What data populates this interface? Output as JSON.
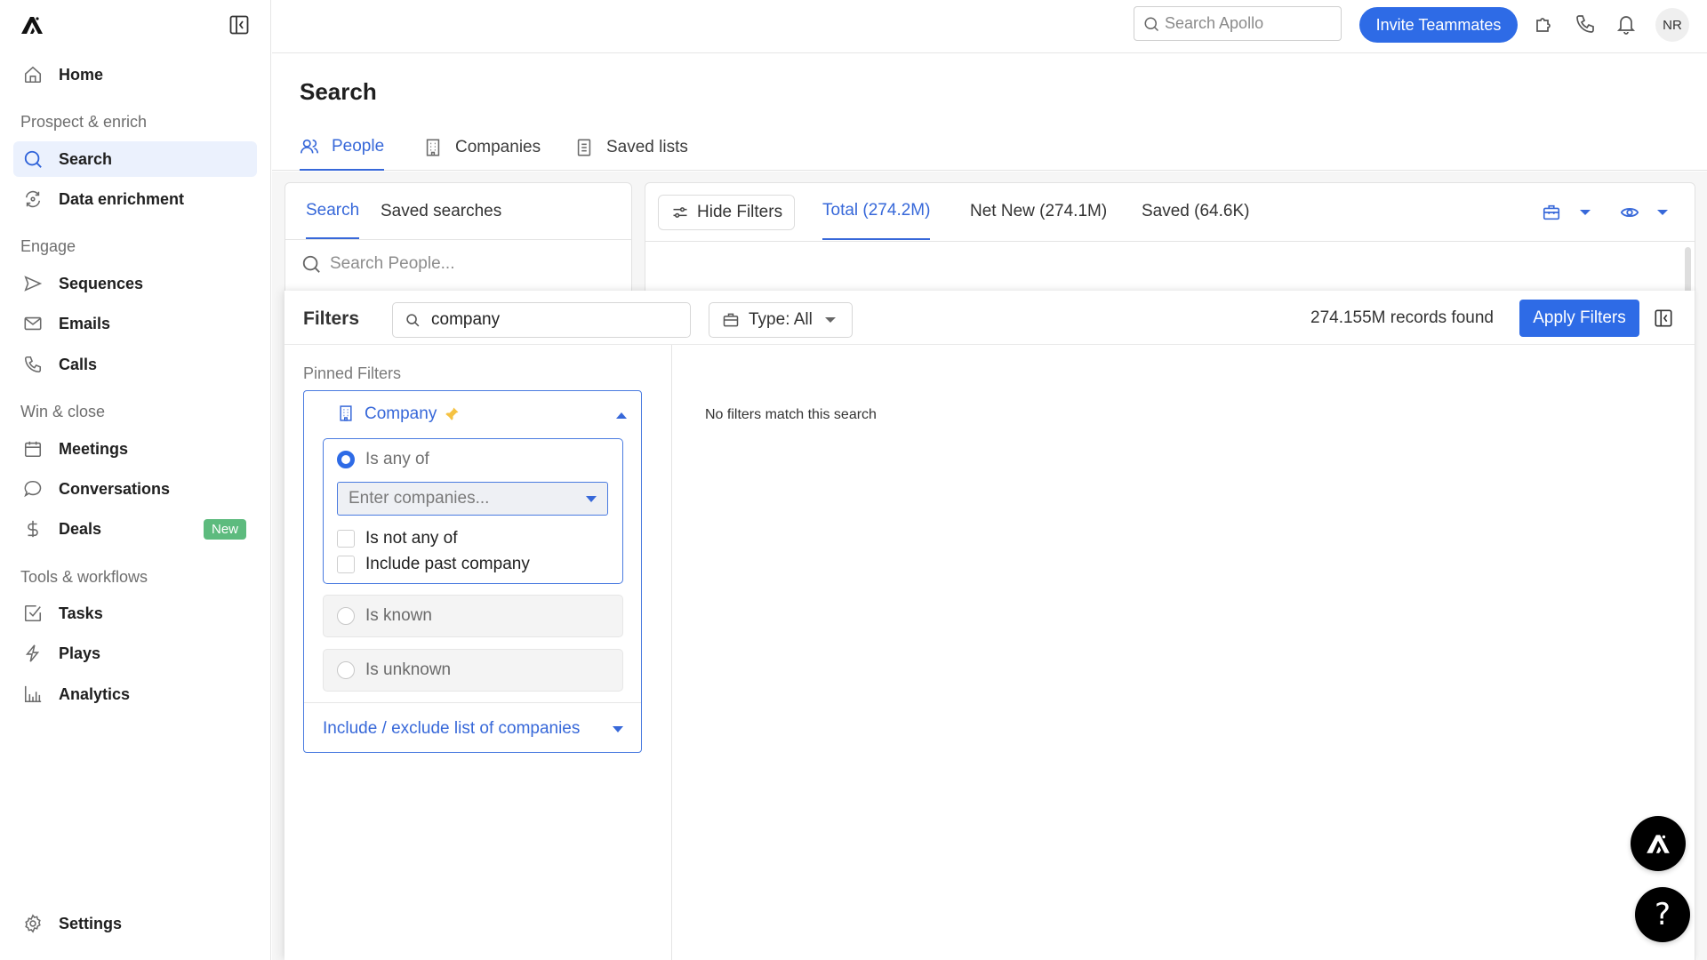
{
  "sidebar": {
    "logo": "apollo-logo",
    "collapse_icon": "sidebar-collapse-icon",
    "home": {
      "label": "Home",
      "icon": "home-icon"
    },
    "sections": [
      {
        "label": "Prospect & enrich",
        "items": [
          {
            "label": "Search",
            "icon": "search-icon",
            "active": true
          },
          {
            "label": "Data enrichment",
            "icon": "refresh-icon",
            "active": false
          }
        ]
      },
      {
        "label": "Engage",
        "items": [
          {
            "label": "Sequences",
            "icon": "send-icon"
          },
          {
            "label": "Emails",
            "icon": "mail-icon"
          },
          {
            "label": "Calls",
            "icon": "phone-icon"
          }
        ]
      },
      {
        "label": "Win & close",
        "items": [
          {
            "label": "Meetings",
            "icon": "calendar-icon"
          },
          {
            "label": "Conversations",
            "icon": "chat-bubble-icon"
          },
          {
            "label": "Deals",
            "icon": "dollar-icon",
            "badge": "New"
          }
        ]
      },
      {
        "label": "Tools & workflows",
        "items": [
          {
            "label": "Tasks",
            "icon": "checkbox-icon"
          },
          {
            "label": "Plays",
            "icon": "lightning-icon"
          },
          {
            "label": "Analytics",
            "icon": "bar-chart-icon"
          }
        ]
      }
    ],
    "settings": {
      "label": "Settings",
      "icon": "gear-icon"
    }
  },
  "topbar": {
    "search_placeholder": "Search Apollo",
    "invite_label": "Invite Teammates",
    "icons": [
      "puzzle-icon",
      "phone-icon",
      "bell-icon"
    ],
    "avatar_initials": "NR"
  },
  "page": {
    "title": "Search",
    "tabs": [
      {
        "label": "People",
        "icon": "people-icon",
        "active": true
      },
      {
        "label": "Companies",
        "icon": "building-icon",
        "active": false
      },
      {
        "label": "Saved lists",
        "icon": "list-icon",
        "active": false
      }
    ]
  },
  "left_panel": {
    "tabs": [
      {
        "label": "Search",
        "active": true
      },
      {
        "label": "Saved searches",
        "active": false
      }
    ],
    "search_placeholder": "Search People..."
  },
  "results_panel": {
    "hide_filters_label": "Hide Filters",
    "tabs": [
      {
        "label": "Total (274.2M)",
        "active": true
      },
      {
        "label": "Net New (274.1M)",
        "active": false
      },
      {
        "label": "Saved (64.6K)",
        "active": false
      }
    ],
    "icons": [
      "briefcase-icon",
      "eye-icon"
    ]
  },
  "filters": {
    "title": "Filters",
    "search_value": "company",
    "type_label": "Type: All",
    "records_found": "274.155M records found",
    "apply_label": "Apply Filters",
    "pinned_label": "Pinned Filters",
    "no_match": "No filters match this search",
    "company_filter": {
      "label": "Company",
      "pinned": true,
      "options": {
        "is_any_of": {
          "label": "Is any of",
          "selected": true
        },
        "input_placeholder": "Enter companies...",
        "is_not_any_of": {
          "label": "Is not any of",
          "checked": false
        },
        "include_past": {
          "label": "Include past company",
          "checked": false
        },
        "is_known": {
          "label": "Is known",
          "selected": false
        },
        "is_unknown": {
          "label": "Is unknown",
          "selected": false
        }
      },
      "include_exclude_label": "Include / exclude list of companies"
    }
  },
  "colors": {
    "accent": "#2e6be6",
    "active_text": "#3768d9",
    "active_bg": "#ebf1fd",
    "badge_green": "#5dbb7e",
    "pin_yellow": "#f5c242"
  },
  "fabs": {
    "assistant_icon": "apollo-logo",
    "help_icon": "help-icon",
    "help_glyph": "?"
  }
}
